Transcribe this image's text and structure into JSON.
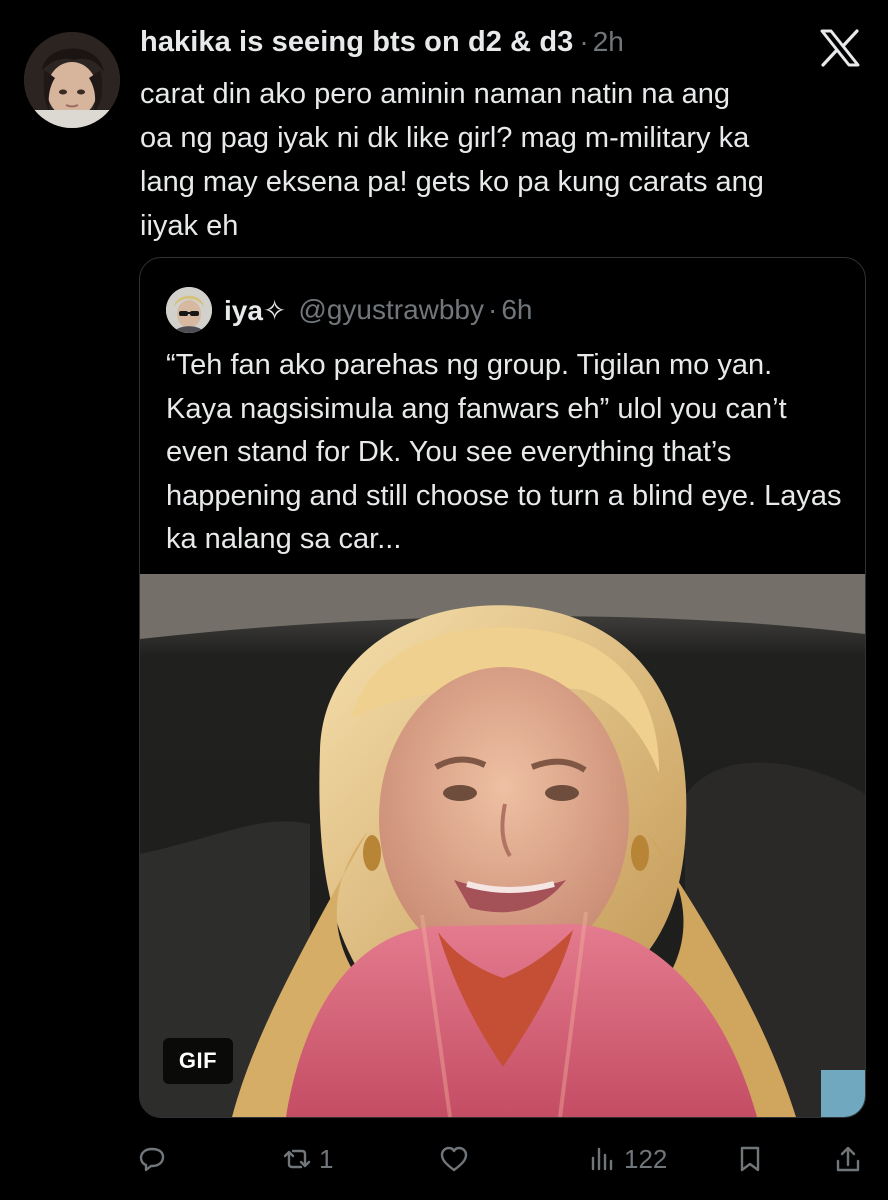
{
  "post": {
    "display_name": "hakika is seeing bts on d2 & d3",
    "separator": "·",
    "time": "2h",
    "text": "carat din ako pero aminin naman natin na ang\noa ng pag iyak ni dk like girl? mag m-military ka\nlang may eksena pa! gets ko pa kung carats ang\niiyak eh",
    "avatar_icon": "profile-photo",
    "brand_icon": "x-logo-icon"
  },
  "quote": {
    "display_name": "iya✧",
    "handle": "@gyustrawbby",
    "separator": "·",
    "time": "6h",
    "text": "“Teh fan ako parehas ng group. Tigilan mo yan. Kaya nagsisimula ang fanwars eh” ulol you can’t even stand for Dk. You see everything that’s happening and still choose to turn a blind eye. Layas ka nalang sa car...",
    "media": {
      "type": "GIF",
      "badge": "GIF"
    }
  },
  "actions": {
    "reply": {
      "icon": "reply-icon",
      "count": ""
    },
    "repost": {
      "icon": "repost-icon",
      "count": "1"
    },
    "like": {
      "icon": "heart-icon",
      "count": ""
    },
    "views": {
      "icon": "views-icon",
      "count": "122"
    },
    "bookmark": {
      "icon": "bookmark-icon",
      "count": ""
    },
    "share": {
      "icon": "share-icon",
      "count": ""
    }
  },
  "colors": {
    "background": "#000000",
    "primary_text": "#e7e9ea",
    "secondary_text": "#71767b",
    "border": "#2f3336"
  }
}
